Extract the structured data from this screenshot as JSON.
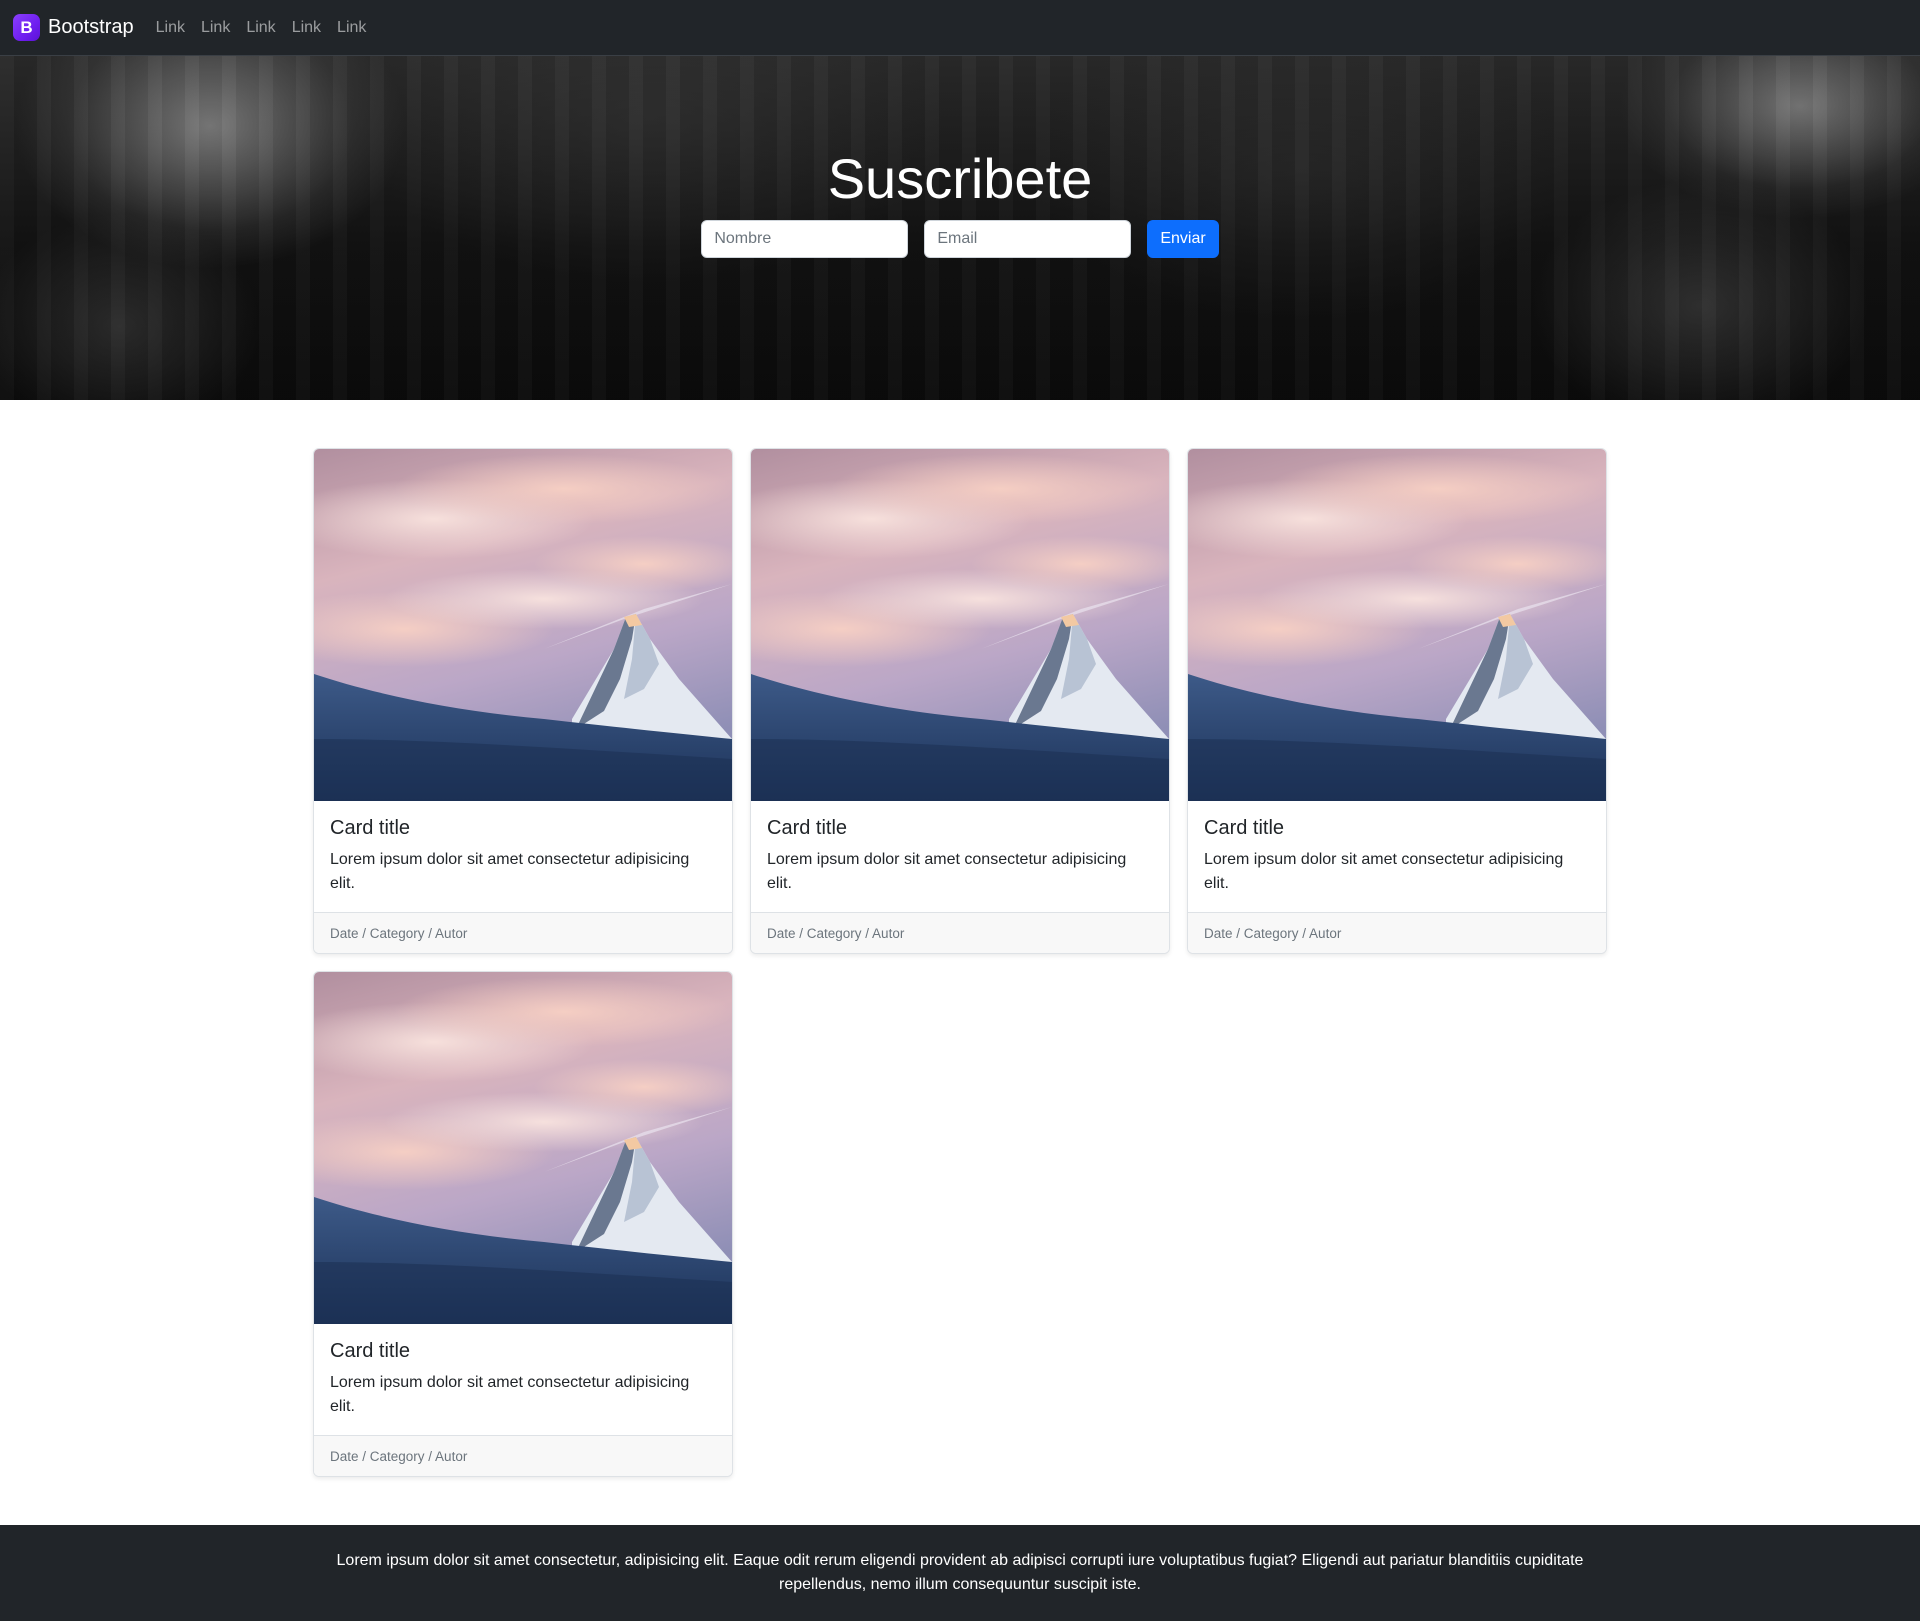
{
  "navbar": {
    "brand_logo_letter": "B",
    "brand": "Bootstrap",
    "links": [
      "Link",
      "Link",
      "Link",
      "Link",
      "Link"
    ]
  },
  "hero": {
    "title": "Suscribete",
    "name_placeholder": "Nombre",
    "email_placeholder": "Email",
    "submit_label": "Enviar"
  },
  "cards": [
    {
      "title": "Card title",
      "text": "Lorem ipsum dolor sit amet consectetur adipisicing elit.",
      "footer": "Date / Category / Autor"
    },
    {
      "title": "Card title",
      "text": "Lorem ipsum dolor sit amet consectetur adipisicing elit.",
      "footer": "Date / Category / Autor"
    },
    {
      "title": "Card title",
      "text": "Lorem ipsum dolor sit amet consectetur adipisicing elit.",
      "footer": "Date / Category / Autor"
    },
    {
      "title": "Card title",
      "text": "Lorem ipsum dolor sit amet consectetur adipisicing elit.",
      "footer": "Date / Category / Autor"
    }
  ],
  "footer": {
    "text": "Lorem ipsum dolor sit amet consectetur, adipisicing elit. Eaque odit rerum eligendi provident ab adipisci corrupti iure voluptatibus fugiat? Eligendi aut pariatur blanditiis cupiditate repellendus, nemo illum consequuntur suscipit iste."
  },
  "colors": {
    "navbar_bg": "#212529",
    "brand_purple": "#7010f0",
    "primary_button": "#0d6efd",
    "footer_bg": "#212529"
  },
  "icons": {
    "brand_logo": "bootstrap-logo-icon"
  }
}
